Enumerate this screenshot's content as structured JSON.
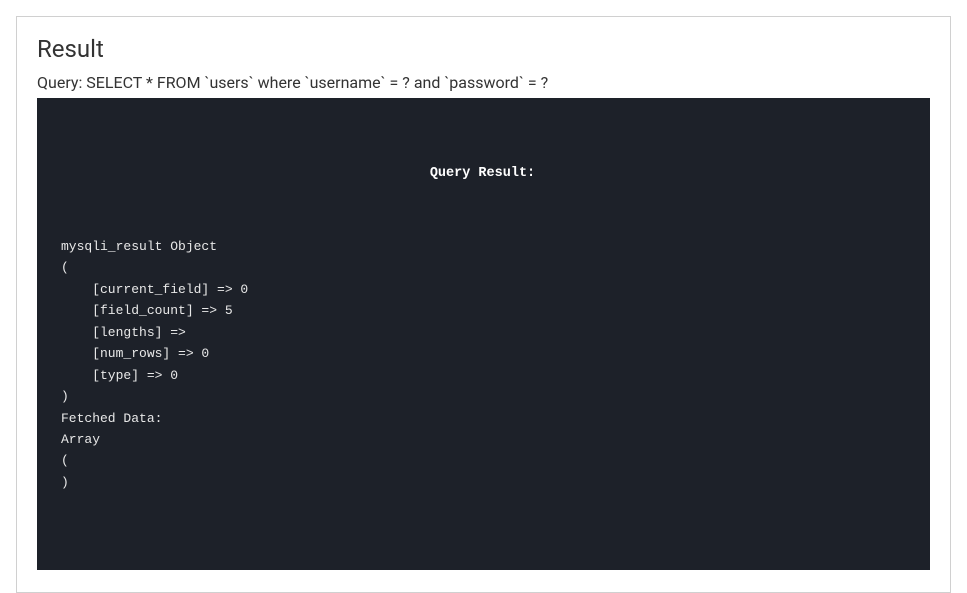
{
  "panel": {
    "title": "Result",
    "query_label": "Query: ",
    "query_text": "SELECT * FROM `users` where `username` = ? and `password` = ?"
  },
  "code": {
    "header": "Query Result:",
    "lines": [
      "mysqli_result Object",
      "(",
      "    [current_field] => 0",
      "    [field_count] => 5",
      "    [lengths] => ",
      "    [num_rows] => 0",
      "    [type] => 0",
      ")",
      "Fetched Data:",
      "Array",
      "(",
      ")"
    ]
  }
}
